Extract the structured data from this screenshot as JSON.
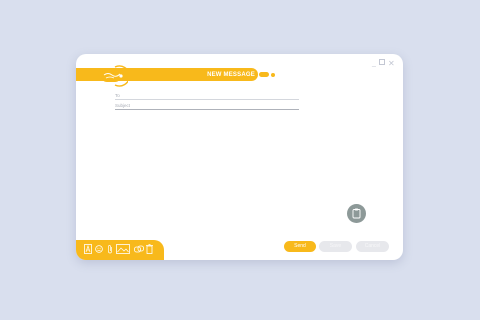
{
  "window": {
    "title": "NEW MESSAGE",
    "controls": {
      "minimize": "_",
      "close": "✕"
    }
  },
  "compose": {
    "to_placeholder": "To",
    "subject_placeholder": "Subject"
  },
  "actions": {
    "send_label": "Send",
    "save_label": "Save",
    "cancel_label": "Cancel"
  },
  "toolbar_icons": [
    "text-format-icon",
    "emoji-icon",
    "attachment-icon",
    "image-icon",
    "link-icon",
    "delete-icon"
  ],
  "fab_icon": "note-icon",
  "colors": {
    "accent": "#f8b91b",
    "background": "#d9dfee",
    "fab": "#8d9998",
    "disabled_button": "#e7e8ec"
  }
}
